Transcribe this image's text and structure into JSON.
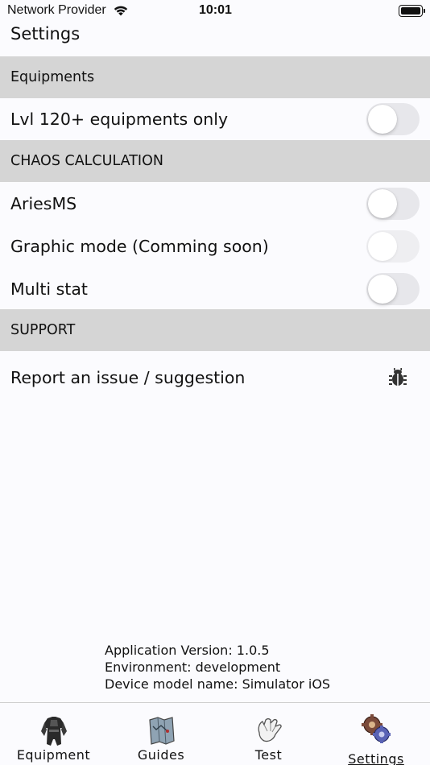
{
  "status_bar": {
    "carrier": "Network Provider",
    "time": "10:01"
  },
  "page": {
    "title": "Settings"
  },
  "sections": {
    "equipments": {
      "header": "Equipments",
      "items": [
        {
          "label": "Lvl 120+ equipments only",
          "toggle_on": false,
          "enabled": true
        }
      ]
    },
    "chaos": {
      "header": "CHAOS CALCULATION",
      "items": [
        {
          "label": "AriesMS",
          "toggle_on": false,
          "enabled": true
        },
        {
          "label": "Graphic mode (Comming soon)",
          "toggle_on": false,
          "enabled": false
        },
        {
          "label": "Multi stat",
          "toggle_on": false,
          "enabled": true
        }
      ]
    },
    "support": {
      "header": "SUPPORT",
      "items": [
        {
          "label": "Report an issue / suggestion",
          "icon": "bug-icon"
        }
      ]
    }
  },
  "version_info": {
    "app_version": "Application Version: 1.0.5",
    "environment": "Environment: development",
    "device": "Device model name: Simulator iOS"
  },
  "tab_bar": {
    "tabs": [
      {
        "label": "Equipment",
        "icon": "armor-icon",
        "active": false
      },
      {
        "label": "Guides",
        "icon": "map-scroll-icon",
        "active": false
      },
      {
        "label": "Test",
        "icon": "glove-icon",
        "active": false
      },
      {
        "label": "Settings",
        "icon": "gears-icon",
        "active": true
      }
    ]
  },
  "colors": {
    "background": "#fbfbfe",
    "section_header": "#d5d5d5",
    "toggle_track": "#e7e7eb"
  }
}
